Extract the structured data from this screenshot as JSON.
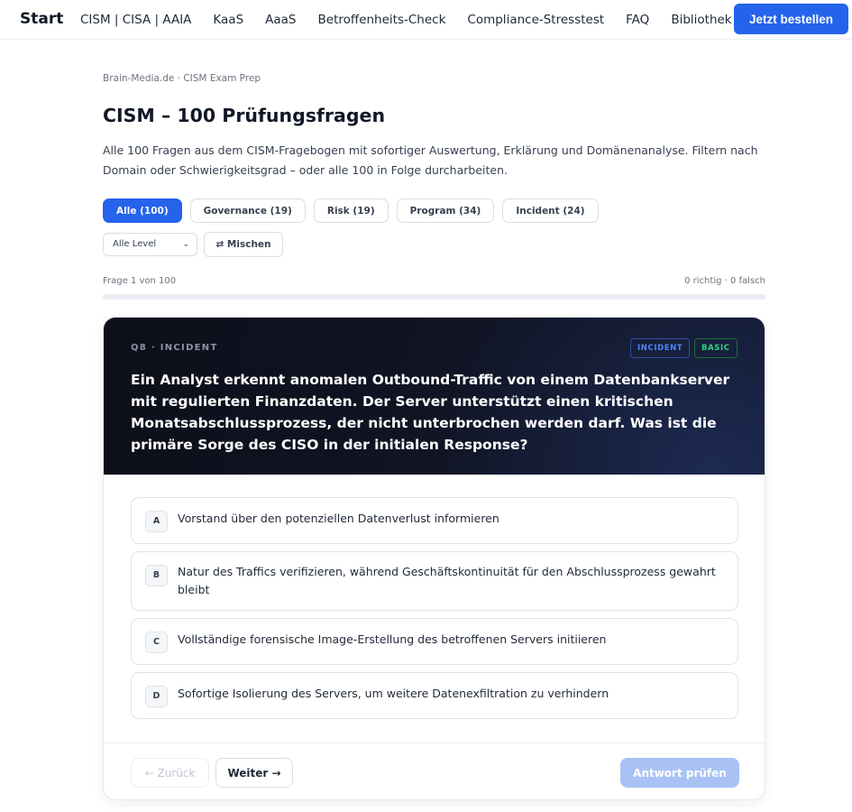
{
  "nav": {
    "brand": "Start",
    "links": [
      "CISM | CISA | AAIA",
      "KaaS",
      "AaaS",
      "Betroffenheits-Check",
      "Compliance-Stresstest",
      "FAQ",
      "Bibliothek"
    ],
    "cta": "Jetzt bestellen"
  },
  "page": {
    "breadcrumb": "Brain-Media.de · CISM Exam Prep",
    "title": "CISM – 100 Prüfungsfragen",
    "description": "Alle 100 Fragen aus dem CISM-Fragebogen mit sofortiger Auswertung, Erklärung und Domänenanalyse. Filtern nach Domain oder Schwierigkeitsgrad – oder alle 100 in Folge durcharbeiten."
  },
  "filters": {
    "domains": [
      {
        "label": "Alle (100)",
        "active": true
      },
      {
        "label": "Governance (19)",
        "active": false
      },
      {
        "label": "Risk (19)",
        "active": false
      },
      {
        "label": "Program (34)",
        "active": false
      },
      {
        "label": "Incident (24)",
        "active": false
      }
    ],
    "level_select": "Alle Level",
    "shuffle_label": "⇄ Mischen"
  },
  "progress": {
    "label": "Frage 1 von 100",
    "score": "0 richtig · 0 falsch",
    "fraction": 0.0
  },
  "question": {
    "id_label": "Q8 · INCIDENT",
    "tags": [
      "INCIDENT",
      "BASIC"
    ],
    "text": "Ein Analyst erkennt anomalen Outbound-Traffic von einem Datenbankserver mit regulierten Finanzdaten. Der Server unterstützt einen kritischen Monatsabschlussprozess, der nicht unterbrochen werden darf. Was ist die primäre Sorge des CISO in der initialen Response?",
    "options": [
      {
        "letter": "A",
        "text": "Vorstand über den potenziellen Datenverlust informieren"
      },
      {
        "letter": "B",
        "text": "Natur des Traffics verifizieren, während Geschäftskontinuität für den Abschlussprozess gewahrt bleibt"
      },
      {
        "letter": "C",
        "text": "Vollständige forensische Image-Erstellung des betroffenen Servers initiieren"
      },
      {
        "letter": "D",
        "text": "Sofortige Isolierung des Servers, um weitere Datenexfiltration zu verhindern"
      }
    ]
  },
  "footer": {
    "back": "← Zurück",
    "next": "Weiter →",
    "check": "Antwort prüfen"
  },
  "colors": {
    "accent": "#2563eb",
    "tag_incident": "#4f86ff",
    "tag_basic": "#2fd47a"
  }
}
